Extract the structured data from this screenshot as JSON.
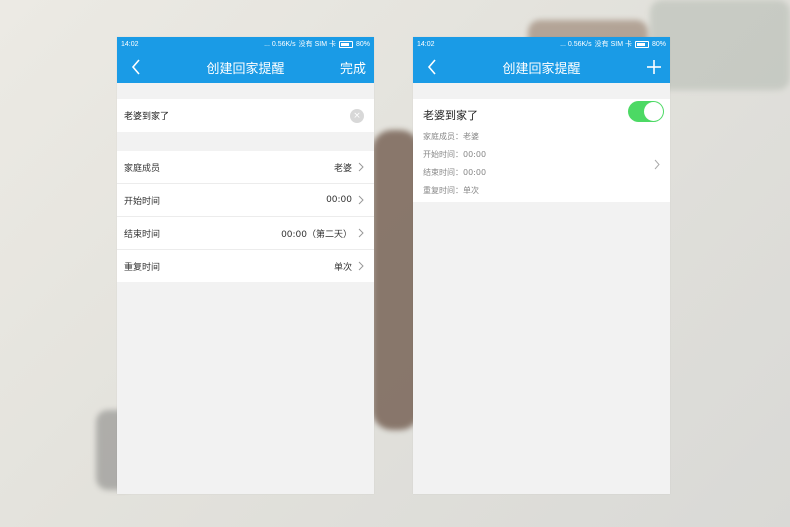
{
  "status_bar": {
    "time": "14:02",
    "speed": "... 0.56K/s",
    "carrier": "没有 SIM 卡",
    "battery": "80%"
  },
  "left_screen": {
    "title": "创建回家提醒",
    "done_label": "完成",
    "name_value": "老婆到家了",
    "clear_icon": "×",
    "settings": [
      {
        "label": "家庭成员",
        "value": "老婆"
      },
      {
        "label": "开始时间",
        "value": "00:00"
      },
      {
        "label": "结束时间",
        "value": "00:00（第二天）"
      },
      {
        "label": "重复时间",
        "value": "单次"
      }
    ]
  },
  "right_screen": {
    "title": "创建回家提醒",
    "reminder": {
      "title": "老婆到家了",
      "enabled": true,
      "member": "家庭成员：老婆",
      "start": "开始时间：00:00",
      "end": "结束时间：00:00",
      "repeat": "重复时间：单次"
    }
  },
  "colors": {
    "header": "#1a9be6",
    "toggle_on": "#4cd964",
    "page_bg": "#f2f2f2"
  },
  "icons": {
    "back": "chevron-left-icon",
    "add": "plus-icon",
    "row": "chevron-right-icon",
    "clear": "clear-icon"
  }
}
